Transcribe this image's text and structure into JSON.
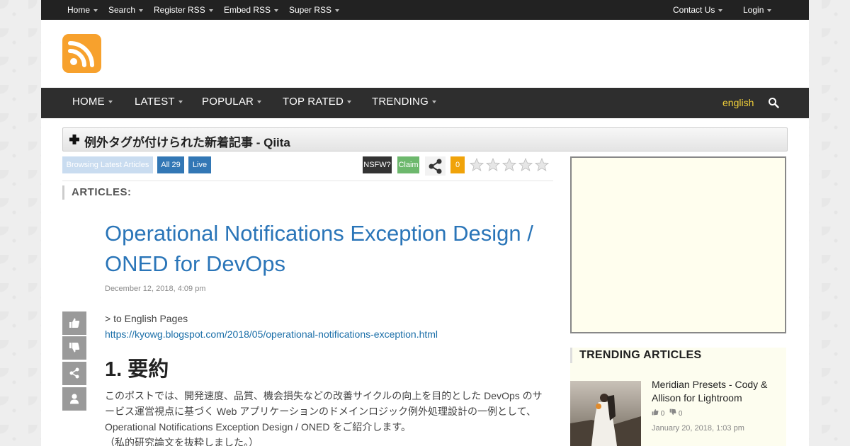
{
  "topbar": {
    "left": [
      "Home",
      "Search",
      "Register RSS",
      "Embed RSS",
      "Super RSS"
    ],
    "right": [
      "Contact Us",
      "Login"
    ]
  },
  "nav": {
    "items": [
      "HOME",
      "LATEST",
      "POPULAR",
      "TOP RATED",
      "TRENDING"
    ],
    "language": "english"
  },
  "feed": {
    "title": "例外タグが付けられた新着記事 - Qiita"
  },
  "tags": {
    "browsing": "Browsing Latest Articles",
    "all": "All 29",
    "live": "Live",
    "nsfw": "NSFW?",
    "claim": "Claim",
    "count": "0",
    "rating": 0
  },
  "section": {
    "heading": "ARTICLES:"
  },
  "article": {
    "title": "Operational Notifications Exception Design / ONED for DevOps",
    "date": "December 12, 2018, 4:09 pm",
    "intro": "> to English Pages",
    "url": "https://kyowg.blogspot.com/2018/05/operational-notifications-exception.html",
    "heading": "1. 要約",
    "paragraph": [
      "このポストでは、開発速度、品質、機会損失などの改善サイクルの向上を目的とした DevOps のサ",
      "ービス運営視点に基づく Web アプリケーションのドメインロジック例外処理設計の一例として、",
      "Operational Notifications Exception Design / ONED をご紹介します。",
      "（私的研究論文を抜粋しました。）"
    ]
  },
  "trending": {
    "heading": "TRENDING ARTICLES",
    "items": [
      {
        "title": "Meridian Presets - Cody & Allison for Lightroom",
        "likes": "0",
        "dislikes": "0",
        "date": "January 20, 2018, 1:03 pm"
      }
    ]
  },
  "colors": {
    "topbar": "#222222",
    "mainnav": "#2e2e2e",
    "logo": "#f7a12d",
    "link": "#2a75b8",
    "language": "#f5d33a",
    "count_badge": "#f0a30a",
    "claim": "#6db86d",
    "all_badge": "#3277b5"
  },
  "icons": [
    "rss-icon",
    "caret-down-icon",
    "search-icon",
    "plus-icon",
    "share-icon",
    "star-icon",
    "thumbs-up-icon",
    "thumbs-down-icon",
    "user-icon"
  ]
}
